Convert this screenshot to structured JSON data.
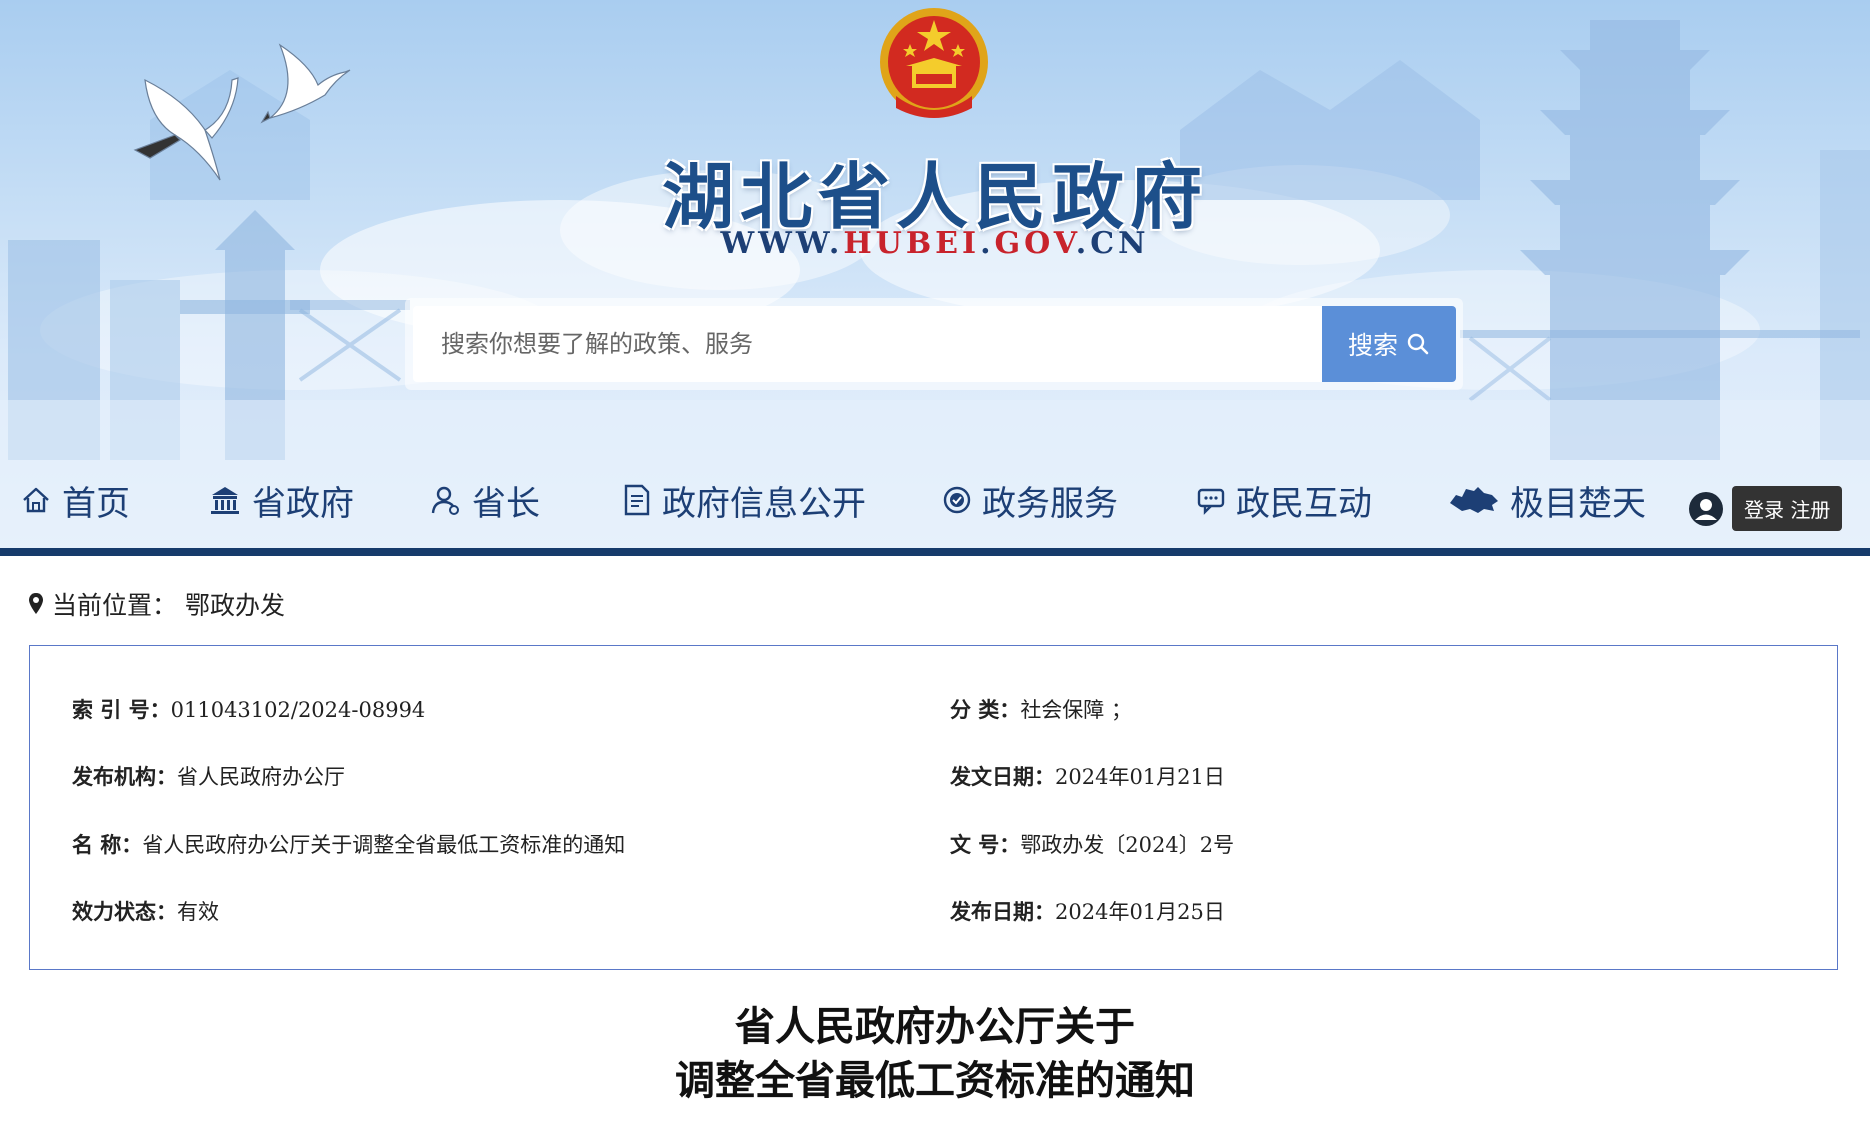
{
  "site": {
    "title": "湖北省人民政府",
    "url_prefix": "WWW.",
    "url_highlight": "HUBEI",
    "url_middle": ".",
    "url_highlight2": "GOV",
    "url_suffix": ".CN",
    "brand_color": "#1d4f8a",
    "accent_red": "#c8232c"
  },
  "search": {
    "placeholder": "搜索你想要了解的政策、服务",
    "button_label": "搜索",
    "button_color": "#5b8fd8"
  },
  "nav": {
    "items": [
      {
        "label": "首页",
        "icon": "home-icon"
      },
      {
        "label": "省政府",
        "icon": "building-icon"
      },
      {
        "label": "省长",
        "icon": "person-icon"
      },
      {
        "label": "政府信息公开",
        "icon": "document-icon"
      },
      {
        "label": "政务服务",
        "icon": "service-icon"
      },
      {
        "label": "政民互动",
        "icon": "chat-icon"
      },
      {
        "label": "极目楚天",
        "icon": "hubei-map-icon"
      }
    ],
    "login_label": "登录 注册",
    "bar_color": "#163b6b"
  },
  "breadcrumb": {
    "label": "当前位置：",
    "current": "鄂政办发"
  },
  "info": {
    "index_key": "索  引  号：",
    "index_val": "011043102/2024-08994",
    "category_key": "分  类：",
    "category_val": "社会保障    ；",
    "publisher_key": "发布机构：",
    "publisher_val": "省人民政府办公厅",
    "issue_date_key": "发文日期：",
    "issue_date_val": "2024年01月21日",
    "name_key": "名  称：",
    "name_val": "省人民政府办公厅关于调整全省最低工资标准的通知",
    "doc_no_key": "文  号：",
    "doc_no_val": "鄂政办发〔2024〕2号",
    "status_key": "效力状态：",
    "status_val": "有效",
    "publish_date_key": "发布日期：",
    "publish_date_val": "2024年01月25日"
  },
  "document": {
    "title_line1": "省人民政府办公厅关于",
    "title_line2": "调整全省最低工资标准的通知"
  }
}
